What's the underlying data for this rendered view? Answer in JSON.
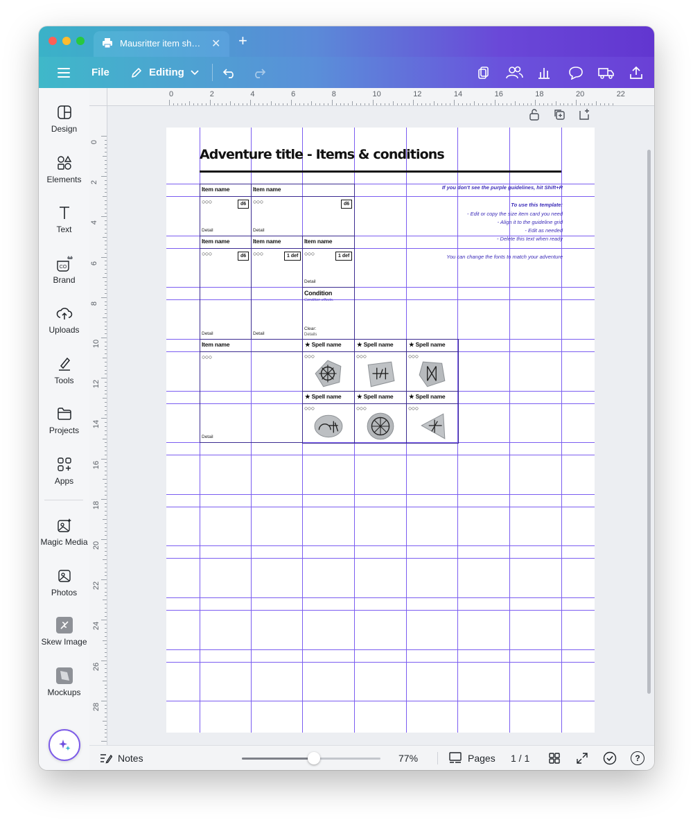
{
  "window": {
    "tab_title": "Mausritter item sh…",
    "new_tab": "+"
  },
  "toolbar": {
    "file_label": "File",
    "editing_label": "Editing"
  },
  "sidebar": {
    "items": [
      {
        "label": "Design",
        "icon": "layout-icon"
      },
      {
        "label": "Elements",
        "icon": "shapes-icon"
      },
      {
        "label": "Text",
        "icon": "text-icon"
      },
      {
        "label": "Brand",
        "icon": "brand-icon"
      },
      {
        "label": "Uploads",
        "icon": "cloud-upload-icon"
      },
      {
        "label": "Tools",
        "icon": "pen-tool-icon"
      },
      {
        "label": "Projects",
        "icon": "folder-icon"
      },
      {
        "label": "Apps",
        "icon": "apps-grid-icon"
      },
      {
        "label": "Magic Media",
        "icon": "magic-media-icon"
      },
      {
        "label": "Photos",
        "icon": "photo-icon"
      },
      {
        "label": "Skew Image",
        "icon": "skew-image-icon"
      },
      {
        "label": "Mockups",
        "icon": "mockups-icon"
      }
    ]
  },
  "rulers": {
    "top": [
      "0",
      "2",
      "4",
      "6",
      "8",
      "10",
      "12",
      "14",
      "16",
      "18",
      "20",
      "22"
    ],
    "left": [
      "0",
      "2",
      "4",
      "6",
      "8",
      "10",
      "12",
      "14",
      "16",
      "18",
      "20",
      "22",
      "24",
      "26",
      "28"
    ]
  },
  "document": {
    "title": "Adventure title - Items & conditions",
    "item_name": "Item name",
    "spell_name": "★ Spell name",
    "slots": "○○○",
    "detail": "Detail",
    "d6": "d6",
    "def": "1 def",
    "condition_title": "Condition",
    "condition_effects": "Condition effects.",
    "clear_label": "Clear:",
    "clear_details": "Details",
    "notes": {
      "purple": "If you don't see the purple guidelines, hit Shift+R",
      "use_title": "To use this template:",
      "step1": "- Edit or copy the size item card you need",
      "step2": "- Align it to the guideline grid",
      "step3": "- Edit as needed",
      "step4": "- Delete this text when ready",
      "fonts": "You can change the fonts to match your adventure"
    }
  },
  "bottombar": {
    "notes_label": "Notes",
    "zoom": "77%",
    "zoom_fraction": 0.52,
    "pages_label": "Pages",
    "page_count": "1 / 1",
    "help": "?"
  },
  "colors": {
    "guideline": "#7a5cf0",
    "accent_start": "#3ab2c8",
    "accent_end": "#6236d0"
  }
}
